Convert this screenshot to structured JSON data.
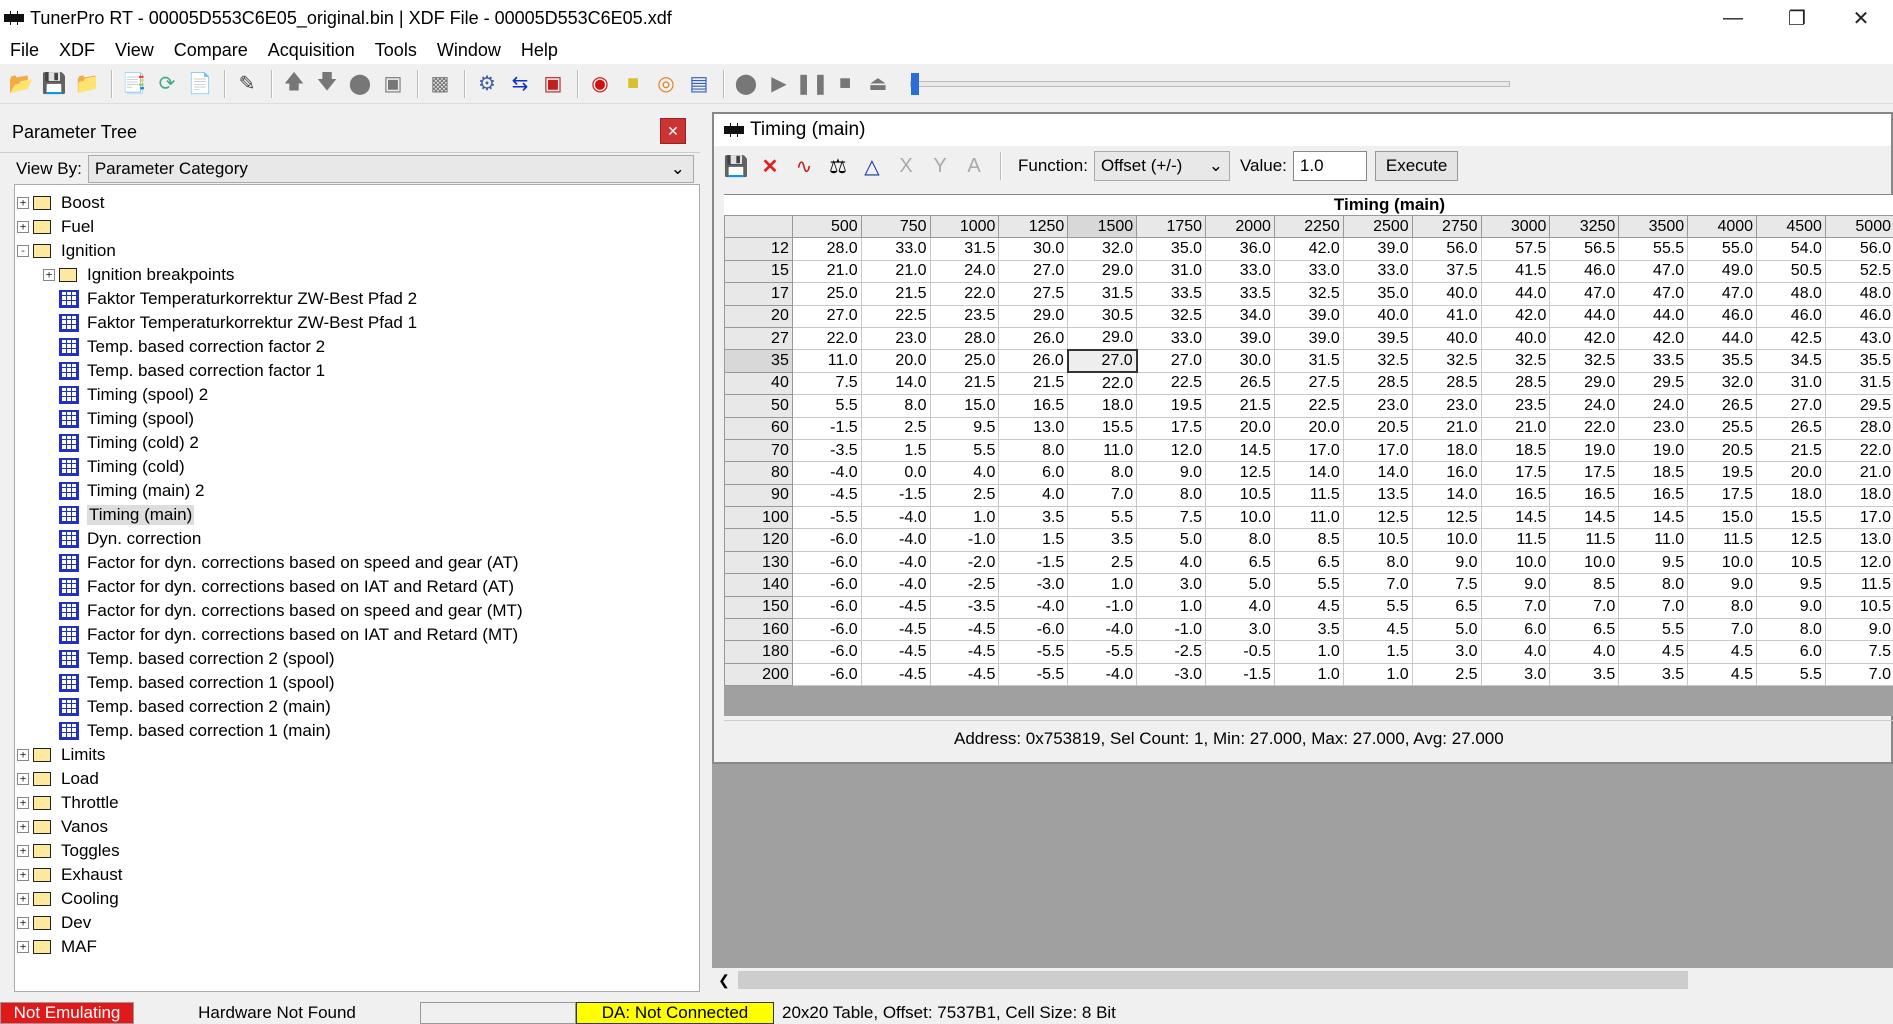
{
  "window": {
    "title": "TunerPro RT - 00005D553C6E05_original.bin | XDF File - 00005D553C6E05.xdf"
  },
  "menu": [
    "File",
    "XDF",
    "View",
    "Compare",
    "Acquisition",
    "Tools",
    "Window",
    "Help"
  ],
  "parameter_tree": {
    "title": "Parameter Tree",
    "view_by_label": "View By:",
    "view_by_value": "Parameter Category",
    "items": [
      {
        "type": "folder",
        "label": "Boost",
        "level": 0,
        "exp": "+"
      },
      {
        "type": "folder",
        "label": "Fuel",
        "level": 0,
        "exp": "+"
      },
      {
        "type": "folder",
        "label": "Ignition",
        "level": 0,
        "exp": "-",
        "open": true
      },
      {
        "type": "folder",
        "label": "Ignition breakpoints",
        "level": 1,
        "exp": "+"
      },
      {
        "type": "table",
        "label": "Faktor Temperaturkorrektur ZW-Best Pfad 2",
        "level": 1
      },
      {
        "type": "table",
        "label": "Faktor Temperaturkorrektur ZW-Best Pfad 1",
        "level": 1
      },
      {
        "type": "table",
        "label": "Temp.  based correction factor 2",
        "level": 1
      },
      {
        "type": "table",
        "label": "Temp.  based correction factor 1",
        "level": 1
      },
      {
        "type": "table",
        "label": "Timing (spool) 2",
        "level": 1
      },
      {
        "type": "table",
        "label": "Timing (spool)",
        "level": 1
      },
      {
        "type": "table",
        "label": "Timing (cold) 2",
        "level": 1
      },
      {
        "type": "table",
        "label": "Timing (cold)",
        "level": 1
      },
      {
        "type": "table",
        "label": "Timing (main) 2",
        "level": 1
      },
      {
        "type": "table",
        "label": "Timing (main)",
        "level": 1,
        "selected": true
      },
      {
        "type": "table",
        "label": "Dyn. correction",
        "level": 1
      },
      {
        "type": "table",
        "label": "Factor for dyn. corrections based on speed and gear (AT)",
        "level": 1
      },
      {
        "type": "table",
        "label": "Factor for dyn. corrections based on IAT and Retard (AT)",
        "level": 1
      },
      {
        "type": "table",
        "label": "Factor for dyn. corrections based on speed and gear (MT)",
        "level": 1
      },
      {
        "type": "table",
        "label": "Factor for dyn. corrections based on IAT and Retard (MT)",
        "level": 1
      },
      {
        "type": "table",
        "label": "Temp. based correction 2 (spool)",
        "level": 1
      },
      {
        "type": "table",
        "label": "Temp. based correction 1 (spool)",
        "level": 1
      },
      {
        "type": "table",
        "label": "Temp. based correction 2 (main)",
        "level": 1
      },
      {
        "type": "table",
        "label": "Temp. based correction 1 (main)",
        "level": 1
      },
      {
        "type": "folder",
        "label": "Limits",
        "level": 0,
        "exp": "+"
      },
      {
        "type": "folder",
        "label": "Load",
        "level": 0,
        "exp": "+"
      },
      {
        "type": "folder",
        "label": "Throttle",
        "level": 0,
        "exp": "+"
      },
      {
        "type": "folder",
        "label": "Vanos",
        "level": 0,
        "exp": "+"
      },
      {
        "type": "folder",
        "label": "Toggles",
        "level": 0,
        "exp": "+"
      },
      {
        "type": "folder",
        "label": "Exhaust",
        "level": 0,
        "exp": "+"
      },
      {
        "type": "folder",
        "label": "Cooling",
        "level": 0,
        "exp": "+"
      },
      {
        "type": "folder",
        "label": "Dev",
        "level": 0,
        "exp": "+"
      },
      {
        "type": "folder",
        "label": "MAF",
        "level": 0,
        "exp": "+"
      }
    ]
  },
  "editor": {
    "title": "Timing (main)",
    "function_label": "Function:",
    "function_value": "Offset (+/-)",
    "value_label": "Value:",
    "value": "1.0",
    "execute_label": "Execute",
    "table_title": "Timing (main)",
    "columns": [
      "500",
      "750",
      "1000",
      "1250",
      "1500",
      "1750",
      "2000",
      "2250",
      "2500",
      "2750",
      "3000",
      "3250",
      "3500",
      "4000",
      "4500",
      "5000"
    ],
    "rows": [
      {
        "h": "12",
        "v": [
          "28.0",
          "33.0",
          "31.5",
          "30.0",
          "32.0",
          "35.0",
          "36.0",
          "42.0",
          "39.0",
          "56.0",
          "57.5",
          "56.5",
          "55.5",
          "55.0",
          "54.0",
          "56.0"
        ]
      },
      {
        "h": "15",
        "v": [
          "21.0",
          "21.0",
          "24.0",
          "27.0",
          "29.0",
          "31.0",
          "33.0",
          "33.0",
          "33.0",
          "37.5",
          "41.5",
          "46.0",
          "47.0",
          "49.0",
          "50.5",
          "52.5"
        ]
      },
      {
        "h": "17",
        "v": [
          "25.0",
          "21.5",
          "22.0",
          "27.5",
          "31.5",
          "33.5",
          "33.5",
          "32.5",
          "35.0",
          "40.0",
          "44.0",
          "47.0",
          "47.0",
          "47.0",
          "48.0",
          "48.0"
        ]
      },
      {
        "h": "20",
        "v": [
          "27.0",
          "22.5",
          "23.5",
          "29.0",
          "30.5",
          "32.5",
          "34.0",
          "39.0",
          "40.0",
          "41.0",
          "42.0",
          "44.0",
          "44.0",
          "46.0",
          "46.0",
          "46.0"
        ]
      },
      {
        "h": "27",
        "v": [
          "22.0",
          "23.0",
          "28.0",
          "26.0",
          "29.0",
          "33.0",
          "39.0",
          "39.0",
          "39.5",
          "40.0",
          "40.0",
          "42.0",
          "42.0",
          "44.0",
          "42.5",
          "43.0"
        ]
      },
      {
        "h": "35",
        "v": [
          "11.0",
          "20.0",
          "25.0",
          "26.0",
          "27.0",
          "27.0",
          "30.0",
          "31.5",
          "32.5",
          "32.5",
          "32.5",
          "32.5",
          "33.5",
          "35.5",
          "34.5",
          "35.5"
        ]
      },
      {
        "h": "40",
        "v": [
          "7.5",
          "14.0",
          "21.5",
          "21.5",
          "22.0",
          "22.5",
          "26.5",
          "27.5",
          "28.5",
          "28.5",
          "28.5",
          "29.0",
          "29.5",
          "32.0",
          "31.0",
          "31.5"
        ]
      },
      {
        "h": "50",
        "v": [
          "5.5",
          "8.0",
          "15.0",
          "16.5",
          "18.0",
          "19.5",
          "21.5",
          "22.5",
          "23.0",
          "23.0",
          "23.5",
          "24.0",
          "24.0",
          "26.5",
          "27.0",
          "29.5"
        ]
      },
      {
        "h": "60",
        "v": [
          "-1.5",
          "2.5",
          "9.5",
          "13.0",
          "15.5",
          "17.5",
          "20.0",
          "20.0",
          "20.5",
          "21.0",
          "21.0",
          "22.0",
          "23.0",
          "25.5",
          "26.5",
          "28.0"
        ]
      },
      {
        "h": "70",
        "v": [
          "-3.5",
          "1.5",
          "5.5",
          "8.0",
          "11.0",
          "12.0",
          "14.5",
          "17.0",
          "17.0",
          "18.0",
          "18.5",
          "19.0",
          "19.0",
          "20.5",
          "21.5",
          "22.0"
        ]
      },
      {
        "h": "80",
        "v": [
          "-4.0",
          "0.0",
          "4.0",
          "6.0",
          "8.0",
          "9.0",
          "12.5",
          "14.0",
          "14.0",
          "16.0",
          "17.5",
          "17.5",
          "18.5",
          "19.5",
          "20.0",
          "21.0"
        ]
      },
      {
        "h": "90",
        "v": [
          "-4.5",
          "-1.5",
          "2.5",
          "4.0",
          "7.0",
          "8.0",
          "10.5",
          "11.5",
          "13.5",
          "14.0",
          "16.5",
          "16.5",
          "16.5",
          "17.5",
          "18.0",
          "18.0"
        ]
      },
      {
        "h": "100",
        "v": [
          "-5.5",
          "-4.0",
          "1.0",
          "3.5",
          "5.5",
          "7.5",
          "10.0",
          "11.0",
          "12.5",
          "12.5",
          "14.5",
          "14.5",
          "14.5",
          "15.0",
          "15.5",
          "17.0"
        ]
      },
      {
        "h": "120",
        "v": [
          "-6.0",
          "-4.0",
          "-1.0",
          "1.5",
          "3.5",
          "5.0",
          "8.0",
          "8.5",
          "10.5",
          "10.0",
          "11.5",
          "11.5",
          "11.0",
          "11.5",
          "12.5",
          "13.0"
        ]
      },
      {
        "h": "130",
        "v": [
          "-6.0",
          "-4.0",
          "-2.0",
          "-1.5",
          "2.5",
          "4.0",
          "6.5",
          "6.5",
          "8.0",
          "9.0",
          "10.0",
          "10.0",
          "9.5",
          "10.0",
          "10.5",
          "12.0"
        ]
      },
      {
        "h": "140",
        "v": [
          "-6.0",
          "-4.0",
          "-2.5",
          "-3.0",
          "1.0",
          "3.0",
          "5.0",
          "5.5",
          "7.0",
          "7.5",
          "9.0",
          "8.5",
          "8.0",
          "9.0",
          "9.5",
          "11.5"
        ]
      },
      {
        "h": "150",
        "v": [
          "-6.0",
          "-4.5",
          "-3.5",
          "-4.0",
          "-1.0",
          "1.0",
          "4.0",
          "4.5",
          "5.5",
          "6.5",
          "7.0",
          "7.0",
          "7.0",
          "8.0",
          "9.0",
          "10.5"
        ]
      },
      {
        "h": "160",
        "v": [
          "-6.0",
          "-4.5",
          "-4.5",
          "-6.0",
          "-4.0",
          "-1.0",
          "3.0",
          "3.5",
          "4.5",
          "5.0",
          "6.0",
          "6.5",
          "5.5",
          "7.0",
          "8.0",
          "9.0"
        ]
      },
      {
        "h": "180",
        "v": [
          "-6.0",
          "-4.5",
          "-4.5",
          "-5.5",
          "-5.5",
          "-2.5",
          "-0.5",
          "1.0",
          "1.5",
          "3.0",
          "4.0",
          "4.0",
          "4.5",
          "4.5",
          "6.0",
          "7.5"
        ]
      },
      {
        "h": "200",
        "v": [
          "-6.0",
          "-4.5",
          "-4.5",
          "-5.5",
          "-4.0",
          "-3.0",
          "-1.5",
          "1.0",
          "1.0",
          "2.5",
          "3.0",
          "3.5",
          "3.5",
          "4.5",
          "5.5",
          "7.0"
        ]
      }
    ],
    "status": "Address: 0x753819, Sel Count: 1, Min: 27.000, Max: 27.000, Avg: 27.000"
  },
  "statusbar": {
    "emulating": "Not Emulating",
    "hardware": "Hardware Not Found",
    "da": "DA: Not Connected",
    "info": "20x20 Table, Offset: 7537B1,  Cell Size: 8 Bit"
  }
}
